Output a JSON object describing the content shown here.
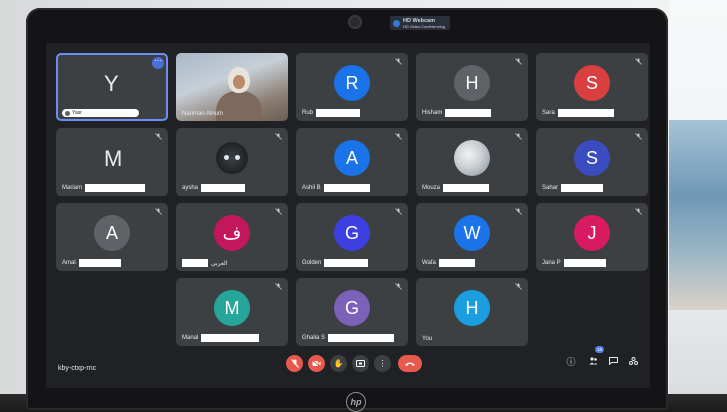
{
  "hd_badge": {
    "title": "HD Webcam",
    "subtitle": "HD Video Conferencing"
  },
  "brand": {
    "logo_text": "hp"
  },
  "meeting": {
    "code": "kby-ctxp-rnc"
  },
  "participants": [
    {
      "name": "Yasr",
      "avatar": "Y",
      "style": "letter",
      "color": "#3c4043",
      "redact_w": 52,
      "is_self_chip": true
    },
    {
      "name": "Nariman Alnum",
      "avatar": "",
      "style": "video",
      "color": "#3c4043",
      "redact_w": 0
    },
    {
      "name": "Rub",
      "avatar": "R",
      "style": "circle",
      "color": "#1a73e8",
      "redact_w": 44
    },
    {
      "name": "Hisham",
      "avatar": "H",
      "style": "circle",
      "color": "#5f6368",
      "redact_w": 46
    },
    {
      "name": "Sara",
      "avatar": "S",
      "style": "circle",
      "color": "#d93f3f",
      "redact_w": 56
    },
    {
      "name": "Mariam",
      "avatar": "M",
      "style": "letter",
      "color": "#3c4043",
      "redact_w": 60
    },
    {
      "name": "aysha",
      "avatar": "",
      "style": "camicon",
      "color": "#3c4043",
      "redact_w": 44
    },
    {
      "name": "Ashil B",
      "avatar": "A",
      "style": "circle",
      "color": "#1a73e8",
      "redact_w": 46
    },
    {
      "name": "Mouza",
      "avatar": "",
      "style": "photo",
      "color": "#3c4043",
      "redact_w": 46
    },
    {
      "name": "Sahar",
      "avatar": "S",
      "style": "circle",
      "color": "#3b4cc0",
      "redact_w": 42
    },
    {
      "name": "Amal",
      "avatar": "A",
      "style": "circle",
      "color": "#5f6368",
      "redact_w": 42
    },
    {
      "name": "",
      "avatar": "ف",
      "style": "circle",
      "color": "#c2185b",
      "redact_w": 26,
      "suffix": "العربي"
    },
    {
      "name": "Golden",
      "avatar": "G",
      "style": "circle",
      "color": "#3d3fe0",
      "redact_w": 44
    },
    {
      "name": "Wafa",
      "avatar": "W",
      "style": "circle",
      "color": "#1a73e8",
      "redact_w": 36
    },
    {
      "name": "Jana P",
      "avatar": "J",
      "style": "circle",
      "color": "#d81b60",
      "redact_w": 42
    },
    {
      "name": "Manal",
      "avatar": "M",
      "style": "circle",
      "color": "#26a69a",
      "redact_w": 58
    },
    {
      "name": "Ghalia S",
      "avatar": "G",
      "style": "circle",
      "color": "#7b61b8",
      "redact_w": 66
    },
    {
      "name": "You",
      "avatar": "H",
      "style": "circle",
      "color": "#1a9ee0",
      "redact_w": 0
    }
  ],
  "controls": {
    "mic": "mic-off",
    "camera": "camera-off",
    "raise_hand": "raise-hand",
    "present": "present",
    "more": "more-options",
    "leave": "leave-call"
  },
  "side_controls": {
    "people_count": "18"
  },
  "colors": {
    "accent": "#6d8ef0",
    "danger": "#e8594d",
    "tile": "#3c4043",
    "screen": "#202124"
  }
}
